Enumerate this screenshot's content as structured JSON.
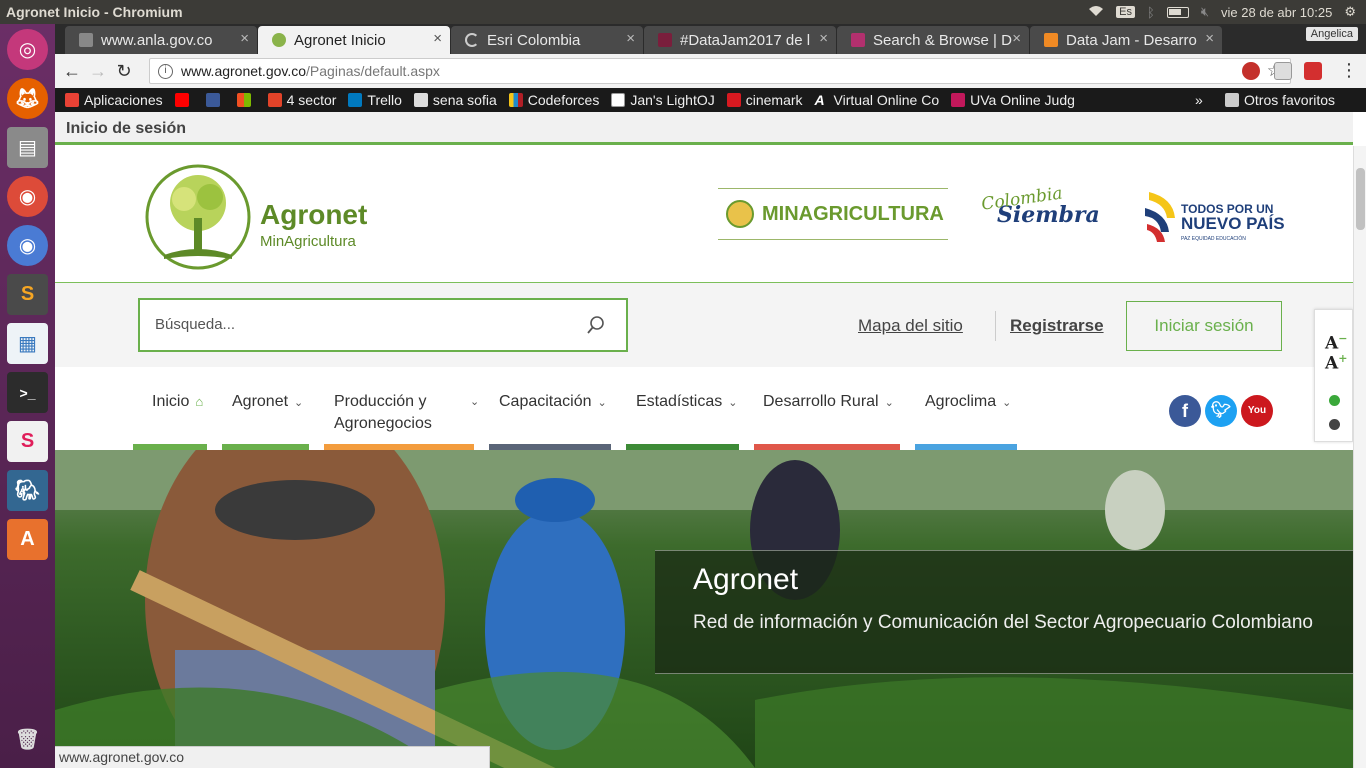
{
  "window": {
    "title": "Agronet Inicio - Chromium"
  },
  "tray": {
    "lang": "Es",
    "datetime": "vie 28 de abr 10:25"
  },
  "launcher": {
    "items": [
      "ubuntu-dash",
      "firefox",
      "files",
      "chrome",
      "chromium",
      "sublime-text",
      "libreoffice-impress",
      "terminal",
      "slack",
      "pgadmin",
      "software-center",
      "trash"
    ]
  },
  "tabs": [
    {
      "label": "www.anla.gov.co",
      "active": false
    },
    {
      "label": "Agronet Inicio",
      "active": true
    },
    {
      "label": "Esri Colombia",
      "active": false
    },
    {
      "label": "#DataJam2017 de l",
      "active": false
    },
    {
      "label": "Search & Browse | D",
      "active": false
    },
    {
      "label": "Data Jam - Desarro",
      "active": false
    }
  ],
  "profile": "Angelica",
  "omnibox": {
    "host": "www.agronet.gov.co",
    "path": "/Paginas/default.aspx"
  },
  "bookmarks": [
    {
      "label": "Aplicaciones",
      "color": "#e94235"
    },
    {
      "label": "",
      "color": "#ff0000"
    },
    {
      "label": "",
      "color": "#3b5998"
    },
    {
      "label": "",
      "color": "#00a4ef"
    },
    {
      "label": "4 sector",
      "color": "#e24329"
    },
    {
      "label": "Trello",
      "color": "#0079bf"
    },
    {
      "label": "sena sofia",
      "color": "#ddd"
    },
    {
      "label": "Codeforces",
      "color": "#1f8acb"
    },
    {
      "label": "Jan's LightOJ",
      "color": "#eee"
    },
    {
      "label": "cinemark",
      "color": "#d71920"
    },
    {
      "label": "Virtual Online Co",
      "color": "#fff"
    },
    {
      "label": "UVa Online Judg",
      "color": "#c2185b"
    }
  ],
  "bookmarks_more": "»",
  "bookmarks_other": "Otros favoritos",
  "site": {
    "login_bar": "Inicio de sesión",
    "logo_name": "Agronet",
    "logo_sub": "MinAgricultura",
    "partner1": "MINAGRICULTURA",
    "partner2a": "Colombia",
    "partner2b": "Siembra",
    "partner3a": "TODOS POR UN",
    "partner3b": "NUEVO PAÍS",
    "partner3c": "PAZ  EQUIDAD  EDUCACIÓN",
    "search_placeholder": "Búsqueda...",
    "sitemap": "Mapa del sitio",
    "register": "Registrarse",
    "login": "Iniciar sesión",
    "nav": [
      {
        "label": "Inicio",
        "color": "#6ab04c"
      },
      {
        "label": "Agronet",
        "color": "#6ab04c"
      },
      {
        "label": "Producción y Agronegocios",
        "color": "#f39c3d"
      },
      {
        "label": "Capacitación",
        "color": "#5a6578"
      },
      {
        "label": "Estadísticas",
        "color": "#3d8b37"
      },
      {
        "label": "Desarrollo Rural",
        "color": "#e0574a"
      },
      {
        "label": "Agroclima",
        "color": "#4aa3e0"
      }
    ],
    "font_increase": "A",
    "font_decrease": "A",
    "hero_title": "Agronet",
    "hero_subtitle": "Red de información y Comunicación del Sector Agropecuario Colombiano"
  },
  "status_url": "www.agronet.gov.co"
}
